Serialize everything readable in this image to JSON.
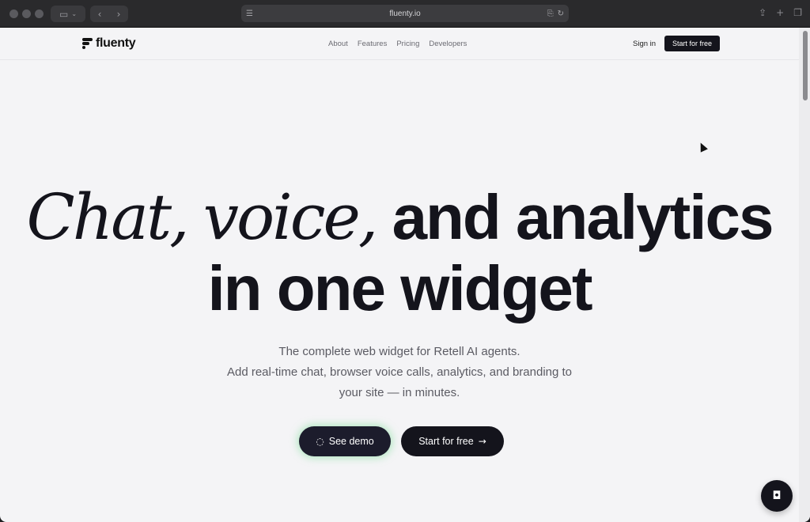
{
  "browser": {
    "url": "fluenty.io"
  },
  "header": {
    "logo_text": "fluenty",
    "nav": [
      "About",
      "Features",
      "Pricing",
      "Developers"
    ],
    "signin": "Sign in",
    "cta": "Start for free"
  },
  "hero": {
    "title_italic_1": "Chat,",
    "title_italic_2": "voice,",
    "title_rest_1": "and analytics",
    "title_line_2": "in one widget",
    "subtitle_1": "The complete web widget for Retell AI agents.",
    "subtitle_2": "Add real-time chat, browser voice calls, analytics, and branding to",
    "subtitle_3": "your site — in minutes.",
    "demo_button": "See demo",
    "start_button": "Start for free"
  },
  "icons": {
    "chat": "chat-bubble-icon",
    "arrow": "arrow-right-icon"
  },
  "colors": {
    "page_bg": "#f4f4f6",
    "ink": "#14141c",
    "muted": "#5b5b63",
    "demo_glow": "#78dc96"
  }
}
